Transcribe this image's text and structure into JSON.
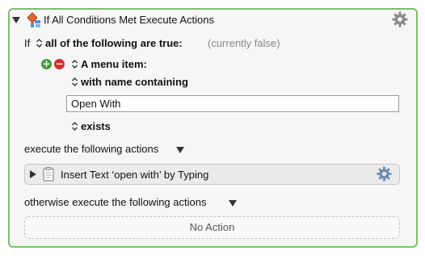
{
  "header": {
    "title": "If All Conditions Met Execute Actions",
    "icon": "if-then-action-icon",
    "gear": "gear-icon"
  },
  "condition": {
    "if_label": "If",
    "match_mode": "all of the following are true:",
    "status": "(currently false)",
    "type_label": "A menu item:",
    "match_label": "with name containing",
    "value": "Open With",
    "test_label": "exists"
  },
  "then_section": {
    "label": "execute the following actions",
    "actions": [
      {
        "title": "Insert Text ‘open with’ by Typing"
      }
    ]
  },
  "else_section": {
    "label": "otherwise execute the following actions",
    "empty_label": "No Action"
  },
  "colors": {
    "border": "#7dbf6e",
    "add": "#3e9d3a",
    "remove": "#d42e2e"
  }
}
